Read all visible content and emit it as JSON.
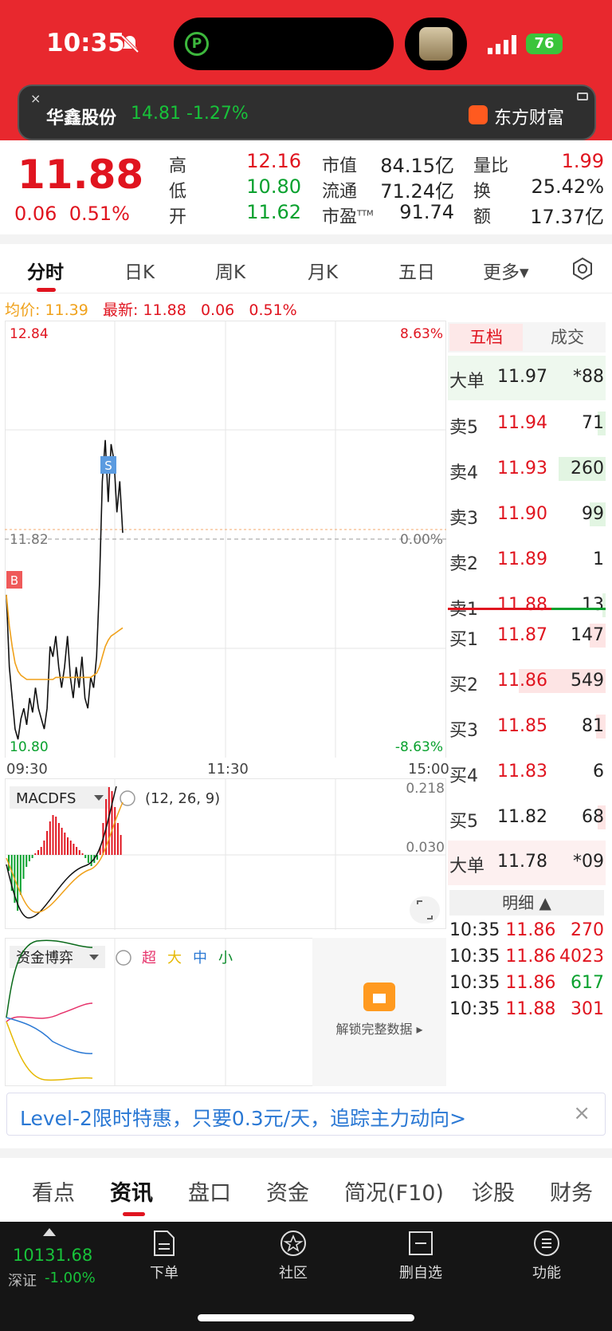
{
  "status": {
    "time": "10:35",
    "battery": "76"
  },
  "banner": {
    "stock_name": "华鑫股份",
    "price_change": "14.81 -1.27%",
    "brand": "东方财富"
  },
  "quote": {
    "price": "11.88",
    "change": "0.06",
    "change_pct": "0.51%",
    "fields": [
      {
        "label": "高",
        "value": "12.16",
        "color": "red"
      },
      {
        "label": "低",
        "value": "10.80",
        "color": "green"
      },
      {
        "label": "开",
        "value": "11.62",
        "color": "green"
      },
      {
        "label": "市值",
        "value": "84.15亿",
        "color": "black"
      },
      {
        "label": "流通",
        "value": "71.24亿",
        "color": "black"
      },
      {
        "label": "市盈",
        "value": "91.74",
        "color": "black"
      },
      {
        "label": "量比",
        "value": "1.99",
        "color": "red"
      },
      {
        "label": "换",
        "value": "25.42%",
        "color": "black"
      },
      {
        "label": "额",
        "value": "17.37亿",
        "color": "black"
      }
    ],
    "pe_suffix": "TTM"
  },
  "tabs": [
    "分时",
    "日K",
    "周K",
    "月K",
    "五日",
    "更多▾"
  ],
  "avgline": {
    "avg_label": "均价: 11.39",
    "latest_label": "最新: 11.88",
    "chg": "0.06",
    "pct": "0.51%"
  },
  "chart_data": [
    {
      "type": "line",
      "title": "",
      "y_top_label": "12.84",
      "y_mid_label": "11.82",
      "y_bottom_label": "10.80",
      "pct_top_label": "8.63%",
      "pct_mid_label": "0.00%",
      "pct_bottom_label": "-8.63%",
      "x_tick_labels": [
        "09:30",
        "11:30",
        "15:00"
      ],
      "ylim": [
        10.8,
        12.84
      ],
      "series": [
        {
          "values": [
            11.55,
            11.2,
            11.05,
            10.9,
            10.85,
            10.95,
            11.0,
            10.92,
            11.05,
            10.98,
            11.1,
            11.0,
            10.95,
            10.9,
            11.0,
            11.3,
            11.25,
            11.35,
            11.2,
            11.1,
            11.2,
            11.35,
            11.15,
            11.05,
            11.2,
            11.1,
            11.25,
            11.05,
            11.0,
            11.15,
            11.1,
            11.25,
            11.6,
            12.1,
            12.3,
            12.0,
            12.28,
            12.2,
            11.95,
            12.1,
            11.85
          ],
          "color": "#111111"
        },
        {
          "values": [
            11.55,
            11.4,
            11.3,
            11.22,
            11.18,
            11.16,
            11.15,
            11.14,
            11.14,
            11.14,
            11.14,
            11.14,
            11.14,
            11.14,
            11.14,
            11.14,
            11.14,
            11.15,
            11.15,
            11.15,
            11.15,
            11.15,
            11.15,
            11.15,
            11.15,
            11.15,
            11.15,
            11.15,
            11.15,
            11.15,
            11.16,
            11.17,
            11.2,
            11.25,
            11.3,
            11.33,
            11.35,
            11.36,
            11.37,
            11.38,
            11.39
          ],
          "color": "#f0a11a"
        }
      ],
      "markers": [
        "B",
        "S"
      ]
    },
    {
      "type": "bar",
      "title": "MACDFS",
      "params": "(12, 26, 9)",
      "y_labels": [
        "0.218",
        "0.030"
      ]
    }
  ],
  "fund": {
    "selector": "资金博弈",
    "legend": [
      "超",
      "大",
      "中",
      "小"
    ],
    "unlock": "解锁完整数据 ▸"
  },
  "book": {
    "tab_left": "五档",
    "tab_right": "成交",
    "top_big": {
      "label": "大单",
      "price": "11.97",
      "vol": "*88"
    },
    "asks": [
      {
        "label": "卖5",
        "price": "11.94",
        "vol": "71",
        "bar": 0.05
      },
      {
        "label": "卖4",
        "price": "11.93",
        "vol": "260",
        "bar": 0.3
      },
      {
        "label": "卖3",
        "price": "11.90",
        "vol": "99",
        "bar": 0.1
      },
      {
        "label": "卖2",
        "price": "11.89",
        "vol": "1",
        "bar": 0
      },
      {
        "label": "卖1",
        "price": "11.88",
        "vol": "13",
        "bar": 0.02
      }
    ],
    "bids": [
      {
        "label": "买1",
        "price": "11.87",
        "vol": "147",
        "bar": 0.1
      },
      {
        "label": "买2",
        "price": "11.86",
        "vol": "549",
        "bar": 0.55
      },
      {
        "label": "买3",
        "price": "11.85",
        "vol": "81",
        "bar": 0.06
      },
      {
        "label": "买4",
        "price": "11.83",
        "vol": "6",
        "bar": 0
      },
      {
        "label": "买5",
        "price": "11.82",
        "vol": "68",
        "bar": 0.05
      }
    ],
    "bottom_big": {
      "label": "大单",
      "price": "11.78",
      "vol": "*09"
    },
    "detail_header": "明细 ▲",
    "details": [
      {
        "time": "10:35",
        "price": "11.86",
        "vol": "270",
        "vol_color": "red"
      },
      {
        "time": "10:35",
        "price": "11.86",
        "vol": "4023",
        "vol_color": "red"
      },
      {
        "time": "10:35",
        "price": "11.86",
        "vol": "617",
        "vol_color": "green"
      },
      {
        "time": "10:35",
        "price": "11.88",
        "vol": "301",
        "vol_color": "red"
      }
    ]
  },
  "promo": {
    "text": "Level-2限时特惠，只要0.3元/天，追踪主力动向>",
    "close": "×"
  },
  "subtabs": [
    "看点",
    "资讯",
    "盘口",
    "资金",
    "简况(F10)",
    "诊股",
    "财务"
  ],
  "bottomnav": {
    "index_value": "10131.68",
    "index_name": "深证",
    "index_change": "-1.00%",
    "items": [
      "下单",
      "社区",
      "删自选",
      "功能"
    ]
  }
}
